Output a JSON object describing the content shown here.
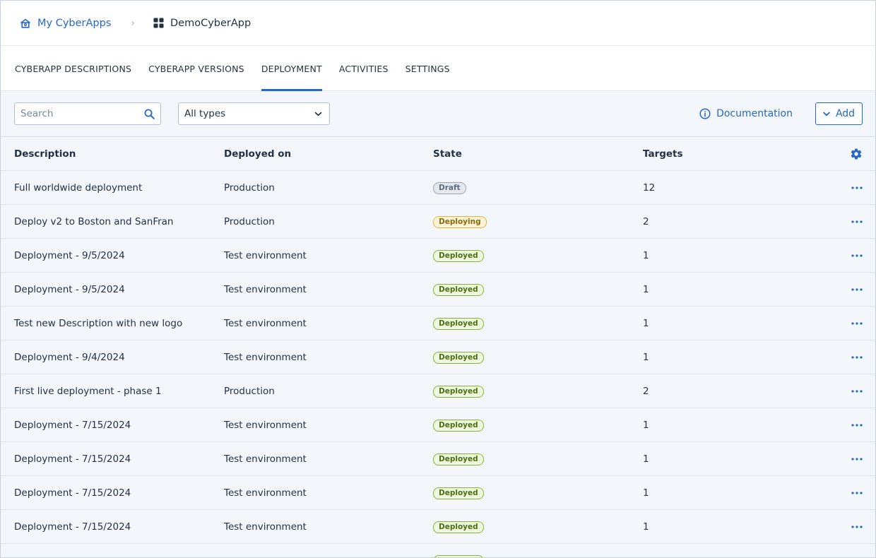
{
  "breadcrumb": {
    "root_label": "My CyberApps",
    "current_label": "DemoCyberApp"
  },
  "tabs": [
    {
      "label": "CYBERAPP DESCRIPTIONS"
    },
    {
      "label": "CYBERAPP VERSIONS"
    },
    {
      "label": "DEPLOYMENT"
    },
    {
      "label": "ACTIVITIES"
    },
    {
      "label": "SETTINGS"
    }
  ],
  "active_tab": "DEPLOYMENT",
  "toolbar": {
    "search_placeholder": "Search",
    "type_filter_value": "All types",
    "documentation_label": "Documentation",
    "add_label": "Add"
  },
  "table": {
    "headers": {
      "description": "Description",
      "deployed_on": "Deployed on",
      "state": "State",
      "targets": "Targets"
    },
    "rows": [
      {
        "description": "Full worldwide deployment",
        "deployed_on": "Production",
        "state": "Draft",
        "targets": "12"
      },
      {
        "description": "Deploy v2 to Boston and SanFran",
        "deployed_on": "Production",
        "state": "Deploying",
        "targets": "2"
      },
      {
        "description": "Deployment - 9/5/2024",
        "deployed_on": "Test environment",
        "state": "Deployed",
        "targets": "1"
      },
      {
        "description": "Deployment - 9/5/2024",
        "deployed_on": "Test environment",
        "state": "Deployed",
        "targets": "1"
      },
      {
        "description": "Test new Description with new logo",
        "deployed_on": "Test environment",
        "state": "Deployed",
        "targets": "1"
      },
      {
        "description": "Deployment - 9/4/2024",
        "deployed_on": "Test environment",
        "state": "Deployed",
        "targets": "1"
      },
      {
        "description": "First live deployment - phase 1",
        "deployed_on": "Production",
        "state": "Deployed",
        "targets": "2"
      },
      {
        "description": "Deployment - 7/15/2024",
        "deployed_on": "Test environment",
        "state": "Deployed",
        "targets": "1"
      },
      {
        "description": "Deployment - 7/15/2024",
        "deployed_on": "Test environment",
        "state": "Deployed",
        "targets": "1"
      },
      {
        "description": "Deployment - 7/15/2024",
        "deployed_on": "Test environment",
        "state": "Deployed",
        "targets": "1"
      },
      {
        "description": "Deployment - 7/15/2024",
        "deployed_on": "Test environment",
        "state": "Deployed",
        "targets": "1"
      },
      {
        "description": "",
        "deployed_on": "",
        "state": "Deployed",
        "targets": ""
      }
    ]
  },
  "icons": {
    "breadcrumb_root": "home-icon",
    "breadcrumb_current": "apps-grid-icon",
    "search": "search-icon",
    "select": "chevron-down-icon",
    "documentation": "info-circle-icon",
    "add": "chevron-down-icon",
    "column_settings": "gear-icon",
    "row_actions": "more-horizontal-icon"
  },
  "colors": {
    "accent": "#2668c5",
    "draft": "#9aa7b6",
    "deploying": "#e0b43a",
    "deployed": "#86b337"
  }
}
